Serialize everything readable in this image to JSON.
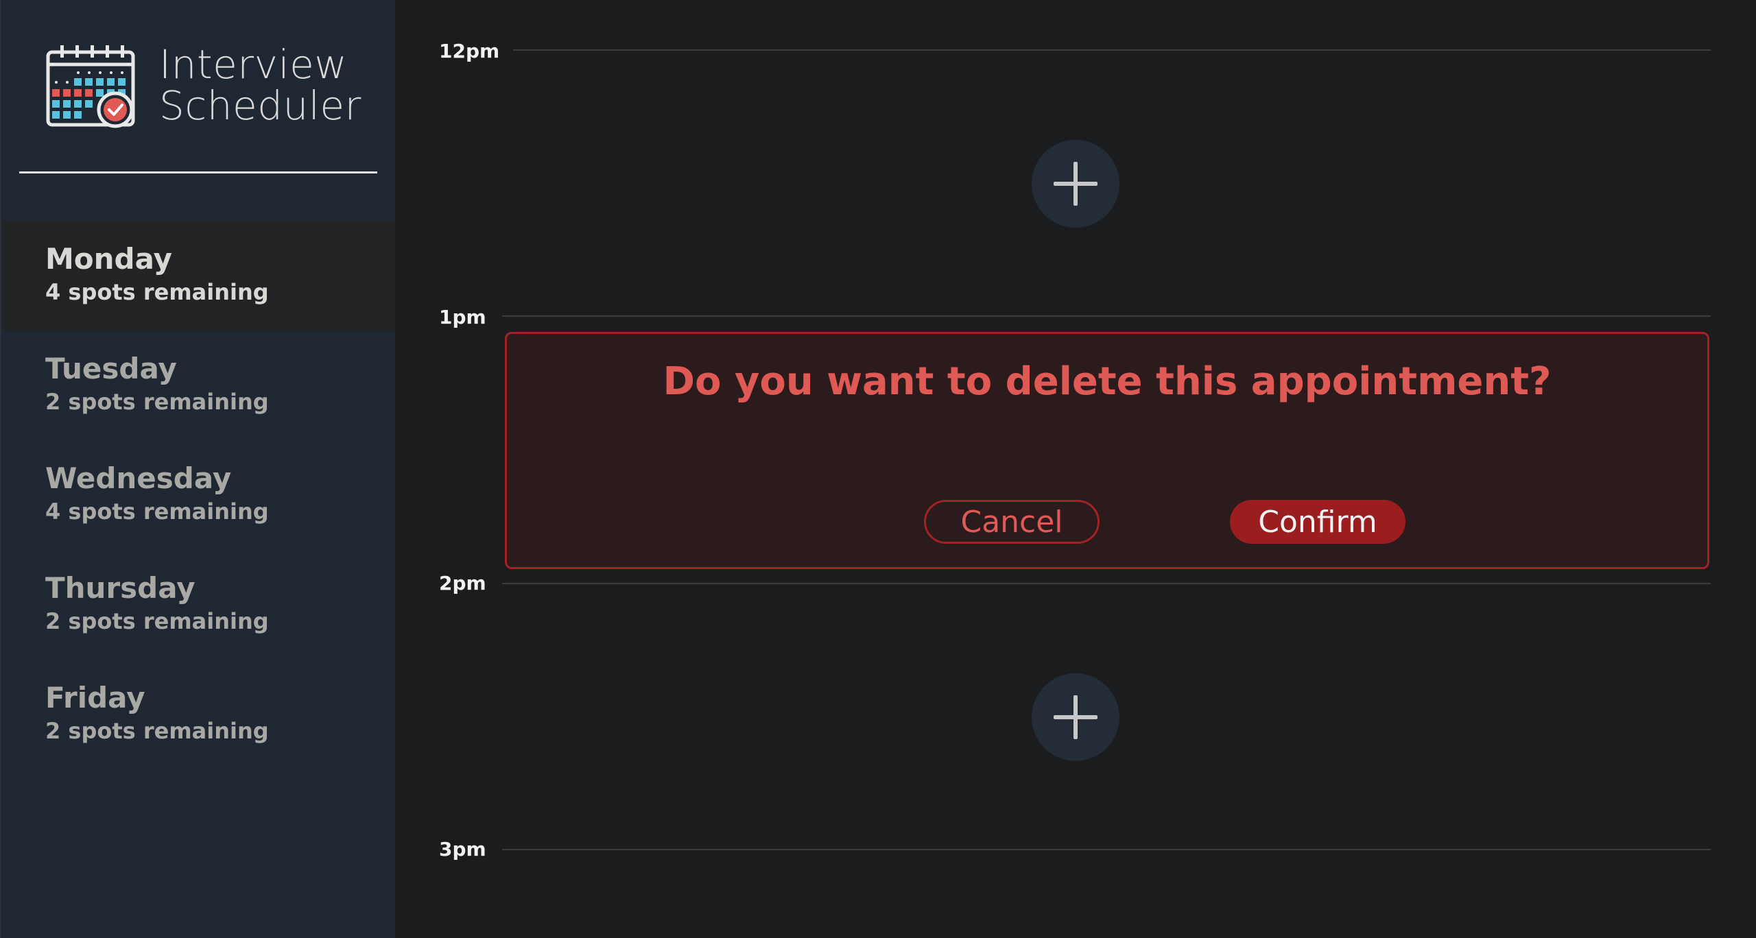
{
  "app": {
    "title_line1": "Interview",
    "title_line2": "Scheduler"
  },
  "sidebar": {
    "days": [
      {
        "name": "Monday",
        "spots": "4 spots remaining",
        "selected": true
      },
      {
        "name": "Tuesday",
        "spots": "2 spots remaining",
        "selected": false
      },
      {
        "name": "Wednesday",
        "spots": "4 spots remaining",
        "selected": false
      },
      {
        "name": "Thursday",
        "spots": "2 spots remaining",
        "selected": false
      },
      {
        "name": "Friday",
        "spots": "2 spots remaining",
        "selected": false
      }
    ]
  },
  "schedule": {
    "hours": [
      "12pm",
      "1pm",
      "2pm",
      "3pm"
    ],
    "confirm": {
      "message": "Do you want to delete this appointment?",
      "cancel_label": "Cancel",
      "confirm_label": "Confirm"
    }
  },
  "colors": {
    "sidebar_bg": "#1f2733",
    "main_bg": "#1b1c1e",
    "danger": "#a32325",
    "danger_text": "#e05a55"
  },
  "icons": {
    "logo": "calendar-check-icon",
    "add": "plus-icon"
  }
}
